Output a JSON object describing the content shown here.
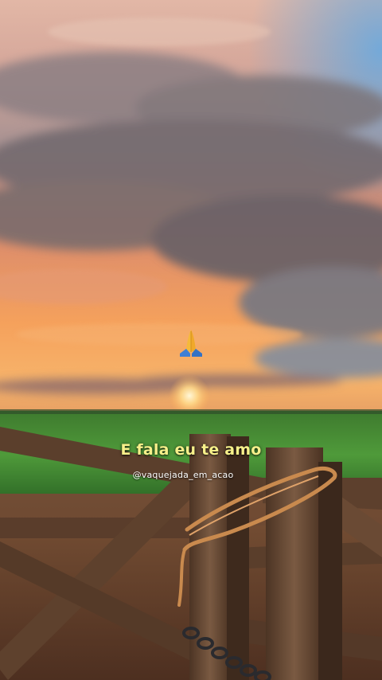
{
  "overlay": {
    "caption": "E fala eu te amo",
    "handle": "@vaquejada_em_acao",
    "emoji_icon": "praying-hands-icon"
  },
  "scene": {
    "subject": "sunset-over-farm-field-with-wooden-gate",
    "colors": {
      "sky_top": "#e9b9a0",
      "sky_horizon": "#f6a25a",
      "cloud_dark": "#6f6a70",
      "sky_blue": "#7fb4e2",
      "field_green": "#3f8c33",
      "wood": "#6b4a33",
      "rope": "#c98a4e",
      "caption_yellow": "#f7f08a"
    }
  }
}
